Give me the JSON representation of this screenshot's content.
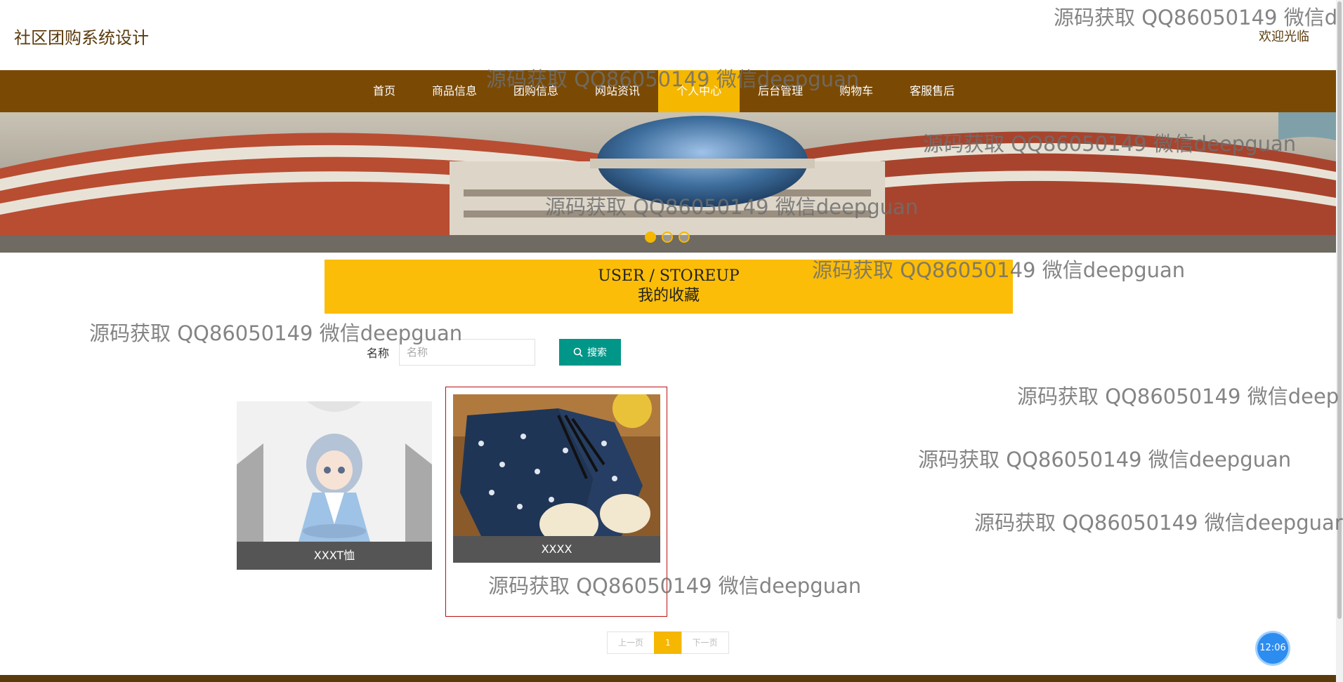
{
  "header": {
    "title": "社区团购系统设计",
    "welcome": "欢迎光临"
  },
  "nav": {
    "items": [
      "首页",
      "商品信息",
      "团购信息",
      "网站资讯",
      "个人中心",
      "后台管理",
      "购物车",
      "客服售后"
    ],
    "active_index": 4
  },
  "banner": {
    "slide_count": 3,
    "active_slide": 1
  },
  "section": {
    "title_en": "USER / STOREUP",
    "title_cn": "我的收藏"
  },
  "search": {
    "label": "名称",
    "placeholder": "名称",
    "value": "",
    "button_label": "搜索"
  },
  "products": [
    {
      "name": "XXXT恤"
    },
    {
      "name": "XXXX"
    }
  ],
  "pagination": {
    "prev": "上一页",
    "current": "1",
    "next": "下一页"
  },
  "clock": "12:06",
  "watermark": "源码获取 QQ86050149 微信deepguan",
  "watermark_partial_a": "源码获取 QQ86050149 微信d",
  "watermark_partial_b": "源码获取 QQ86050149 微信deep",
  "watermark_partial_c": "源码获取 QQ86050149 微信deepguar",
  "colors": {
    "nav_bg": "#7a4a05",
    "accent": "#f5b700",
    "section_bg": "#fbbd08",
    "search_button": "#009688",
    "card_label_bg": "#555555",
    "selected_frame": "#bb1111"
  }
}
